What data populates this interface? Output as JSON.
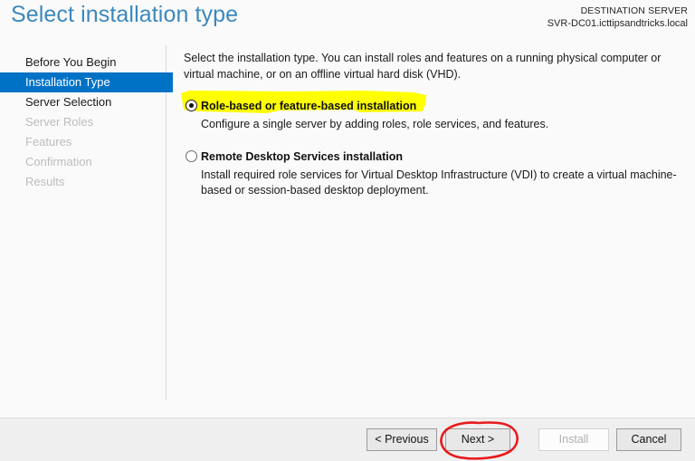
{
  "header": {
    "title": "Select installation type",
    "destination_label": "DESTINATION SERVER",
    "destination_server": "SVR-DC01.icttipsandtricks.local"
  },
  "sidebar": {
    "items": [
      {
        "label": "Before You Begin",
        "state": "enabled"
      },
      {
        "label": "Installation Type",
        "state": "selected"
      },
      {
        "label": "Server Selection",
        "state": "enabled"
      },
      {
        "label": "Server Roles",
        "state": "disabled"
      },
      {
        "label": "Features",
        "state": "disabled"
      },
      {
        "label": "Confirmation",
        "state": "disabled"
      },
      {
        "label": "Results",
        "state": "disabled"
      }
    ]
  },
  "main": {
    "intro": "Select the installation type. You can install roles and features on a running physical computer or virtual machine, or on an offline virtual hard disk (VHD).",
    "options": [
      {
        "label": "Role-based or feature-based installation",
        "description": "Configure a single server by adding roles, role services, and features.",
        "selected": true,
        "highlighted": true
      },
      {
        "label": "Remote Desktop Services installation",
        "description": "Install required role services for Virtual Desktop Infrastructure (VDI) to create a virtual machine-based or session-based desktop deployment.",
        "selected": false,
        "highlighted": false
      }
    ]
  },
  "footer": {
    "buttons": [
      {
        "label": "< Previous",
        "state": "enabled"
      },
      {
        "label": "Next >",
        "state": "enabled",
        "annotated": true
      },
      {
        "label": "Install",
        "state": "disabled"
      },
      {
        "label": "Cancel",
        "state": "enabled"
      }
    ]
  },
  "annotations": {
    "highlight_color": "#ffff00",
    "circle_color": "#e8191b"
  },
  "colors": {
    "accent_blue": "#0072c6",
    "title_blue": "#3b88bd",
    "page_background": "#fafafa",
    "footer_background": "#efefef",
    "disabled_text": "#bcbcbc"
  }
}
